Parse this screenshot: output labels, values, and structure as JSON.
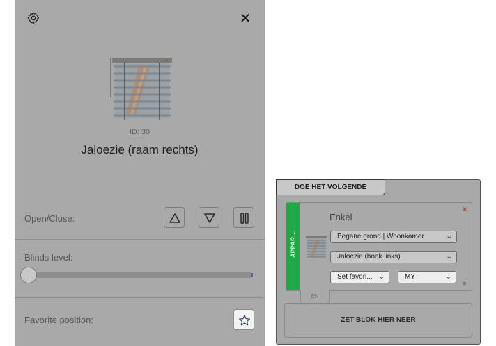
{
  "device_panel": {
    "device_id": "ID: 30",
    "device_name": "Jaloezie (raam rechts)",
    "open_close_label": "Open/Close:",
    "blinds_level_label": "Blinds level:",
    "blinds_level_value": 0,
    "favorite_label": "Favorite position:",
    "icons": [
      "gear-icon",
      "close-icon",
      "triangle-up-icon",
      "triangle-down-icon",
      "pause-icon",
      "star-icon"
    ]
  },
  "workspace": {
    "tab_label": "DOE HET VOLGENDE",
    "block": {
      "category": "APPAR...",
      "title": "Enkel",
      "location": "Begane grond | Woonkamer",
      "device": "Jaloezie (hoek links)",
      "favorite_select": "Set favori...",
      "favorite_value": "MY",
      "remove_icon": "×",
      "handle_icon": "≡"
    },
    "lang_tab": "EN",
    "drop_zone": "ZET BLOK HIER NEER",
    "colors": {
      "block_strip": "#1faa45",
      "remove": "#c0392b"
    }
  },
  "ui_glyphs": {
    "close": "✕",
    "chevron": "⌄"
  }
}
